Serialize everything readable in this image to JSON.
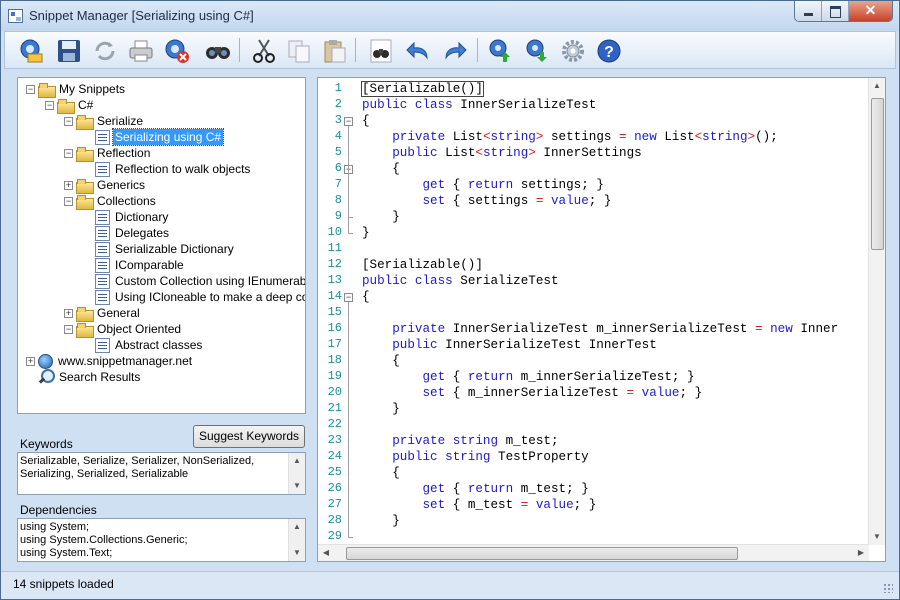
{
  "window": {
    "title": "Snippet Manager [Serializing using C#]"
  },
  "tree": {
    "items": [
      {
        "label": "My Snippets",
        "level": 0,
        "icon": "folder",
        "expanded": true
      },
      {
        "label": "C#",
        "level": 1,
        "icon": "folder",
        "expanded": true
      },
      {
        "label": "Serialize",
        "level": 2,
        "icon": "folder",
        "expanded": true
      },
      {
        "label": "Serializing using C#",
        "level": 3,
        "icon": "document",
        "selected": true
      },
      {
        "label": "Reflection",
        "level": 2,
        "icon": "folder",
        "expanded": true
      },
      {
        "label": "Reflection to walk objects",
        "level": 3,
        "icon": "document"
      },
      {
        "label": "Generics",
        "level": 2,
        "icon": "folder",
        "expanded": false
      },
      {
        "label": "Collections",
        "level": 2,
        "icon": "folder",
        "expanded": true
      },
      {
        "label": "Dictionary",
        "level": 3,
        "icon": "document"
      },
      {
        "label": "Delegates",
        "level": 3,
        "icon": "document"
      },
      {
        "label": "Serializable Dictionary",
        "level": 3,
        "icon": "document"
      },
      {
        "label": "IComparable",
        "level": 3,
        "icon": "document"
      },
      {
        "label": "Custom Collection using IEnumerable",
        "level": 3,
        "icon": "document"
      },
      {
        "label": "Using ICloneable to make a deep copy",
        "level": 3,
        "icon": "document"
      },
      {
        "label": "General",
        "level": 2,
        "icon": "folder",
        "expanded": false
      },
      {
        "label": "Object Oriented",
        "level": 2,
        "icon": "folder",
        "expanded": true
      },
      {
        "label": "Abstract classes",
        "level": 3,
        "icon": "document"
      },
      {
        "label": "www.snippetmanager.net",
        "level": 0,
        "icon": "globe",
        "expanded": false
      },
      {
        "label": "Search Results",
        "level": 0,
        "icon": "search"
      }
    ]
  },
  "keywords": {
    "label": "Keywords",
    "suggest_button": "Suggest Keywords",
    "value_line1": "Serializable, Serialize, Serializer, NonSerialized,",
    "value_line2": "Serializing, Serialized, Serializable"
  },
  "dependencies": {
    "label": "Dependencies",
    "line1": "using System;",
    "line2": "using System.Collections.Generic;",
    "line3": "using System.Text;"
  },
  "editor": {
    "lines": [
      [
        [
          "cur",
          "[Serializable()]"
        ]
      ],
      [
        [
          "kw",
          "public class"
        ],
        [
          "t",
          " InnerSerializeTest"
        ]
      ],
      [
        [
          "t",
          "{"
        ]
      ],
      [
        [
          "t",
          "    "
        ],
        [
          "kw",
          "private"
        ],
        [
          "t",
          " List"
        ],
        [
          "op",
          "<"
        ],
        [
          "kw",
          "string"
        ],
        [
          "op",
          ">"
        ],
        [
          "t",
          " settings "
        ],
        [
          "op",
          "="
        ],
        [
          "t",
          " "
        ],
        [
          "kw",
          "new"
        ],
        [
          "t",
          " List"
        ],
        [
          "op",
          "<"
        ],
        [
          "kw",
          "string"
        ],
        [
          "op",
          ">"
        ],
        [
          "t",
          "();"
        ]
      ],
      [
        [
          "t",
          "    "
        ],
        [
          "kw",
          "public"
        ],
        [
          "t",
          " List"
        ],
        [
          "op",
          "<"
        ],
        [
          "kw",
          "string"
        ],
        [
          "op",
          ">"
        ],
        [
          "t",
          " InnerSettings"
        ]
      ],
      [
        [
          "t",
          "    {"
        ]
      ],
      [
        [
          "t",
          "        "
        ],
        [
          "kw",
          "get"
        ],
        [
          "t",
          " { "
        ],
        [
          "kw",
          "return"
        ],
        [
          "t",
          " settings; }"
        ]
      ],
      [
        [
          "t",
          "        "
        ],
        [
          "kw",
          "set"
        ],
        [
          "t",
          " { settings "
        ],
        [
          "op",
          "="
        ],
        [
          "t",
          " "
        ],
        [
          "kw",
          "value"
        ],
        [
          "t",
          "; }"
        ]
      ],
      [
        [
          "t",
          "    }"
        ]
      ],
      [
        [
          "t",
          "}"
        ]
      ],
      [
        [
          "t",
          ""
        ]
      ],
      [
        [
          "t",
          "[Serializable()]"
        ]
      ],
      [
        [
          "kw",
          "public class"
        ],
        [
          "t",
          " SerializeTest"
        ]
      ],
      [
        [
          "t",
          "{"
        ]
      ],
      [
        [
          "t",
          ""
        ]
      ],
      [
        [
          "t",
          "    "
        ],
        [
          "kw",
          "private"
        ],
        [
          "t",
          " InnerSerializeTest m_innerSerializeTest "
        ],
        [
          "op",
          "="
        ],
        [
          "t",
          " "
        ],
        [
          "kw",
          "new"
        ],
        [
          "t",
          " Inner"
        ]
      ],
      [
        [
          "t",
          "    "
        ],
        [
          "kw",
          "public"
        ],
        [
          "t",
          " InnerSerializeTest InnerTest"
        ]
      ],
      [
        [
          "t",
          "    {"
        ]
      ],
      [
        [
          "t",
          "        "
        ],
        [
          "kw",
          "get"
        ],
        [
          "t",
          " { "
        ],
        [
          "kw",
          "return"
        ],
        [
          "t",
          " m_innerSerializeTest; }"
        ]
      ],
      [
        [
          "t",
          "        "
        ],
        [
          "kw",
          "set"
        ],
        [
          "t",
          " { m_innerSerializeTest "
        ],
        [
          "op",
          "="
        ],
        [
          "t",
          " "
        ],
        [
          "kw",
          "value"
        ],
        [
          "t",
          "; }"
        ]
      ],
      [
        [
          "t",
          "    }"
        ]
      ],
      [
        [
          "t",
          ""
        ]
      ],
      [
        [
          "t",
          "    "
        ],
        [
          "kw",
          "private string"
        ],
        [
          "t",
          " m_test;"
        ]
      ],
      [
        [
          "t",
          "    "
        ],
        [
          "kw",
          "public string"
        ],
        [
          "t",
          " TestProperty"
        ]
      ],
      [
        [
          "t",
          "    {"
        ]
      ],
      [
        [
          "t",
          "        "
        ],
        [
          "kw",
          "get"
        ],
        [
          "t",
          " { "
        ],
        [
          "kw",
          "return"
        ],
        [
          "t",
          " m_test; }"
        ]
      ],
      [
        [
          "t",
          "        "
        ],
        [
          "kw",
          "set"
        ],
        [
          "t",
          " { m_test "
        ],
        [
          "op",
          "="
        ],
        [
          "t",
          " "
        ],
        [
          "kw",
          "value"
        ],
        [
          "t",
          "; }"
        ]
      ],
      [
        [
          "t",
          "    }"
        ]
      ],
      [
        [
          "t",
          ""
        ]
      ]
    ],
    "line_numbers": [
      "1",
      "2",
      "3",
      "4",
      "5",
      "6",
      "7",
      "8",
      "9",
      "10",
      "11",
      "12",
      "13",
      "14",
      "15",
      "16",
      "17",
      "18",
      "19",
      "20",
      "21",
      "22",
      "23",
      "24",
      "25",
      "26",
      "27",
      "28",
      "29"
    ]
  },
  "toolbar": {
    "buttons": [
      "new-snippet-icon",
      "save-icon",
      "refresh-icon",
      "print-icon",
      "delete-snippet-icon",
      "find-icon",
      "cut-icon",
      "copy-icon",
      "paste-icon",
      "find-next-icon",
      "undo-icon",
      "redo-icon",
      "export-icon",
      "import-icon",
      "settings-icon",
      "help-icon"
    ]
  },
  "status": {
    "text": "14 snippets loaded"
  },
  "colors": {
    "keyword": "#1c19d6",
    "operator": "#d11e1e",
    "line_number": "#1a8f9a",
    "selection": "#3399ff"
  }
}
